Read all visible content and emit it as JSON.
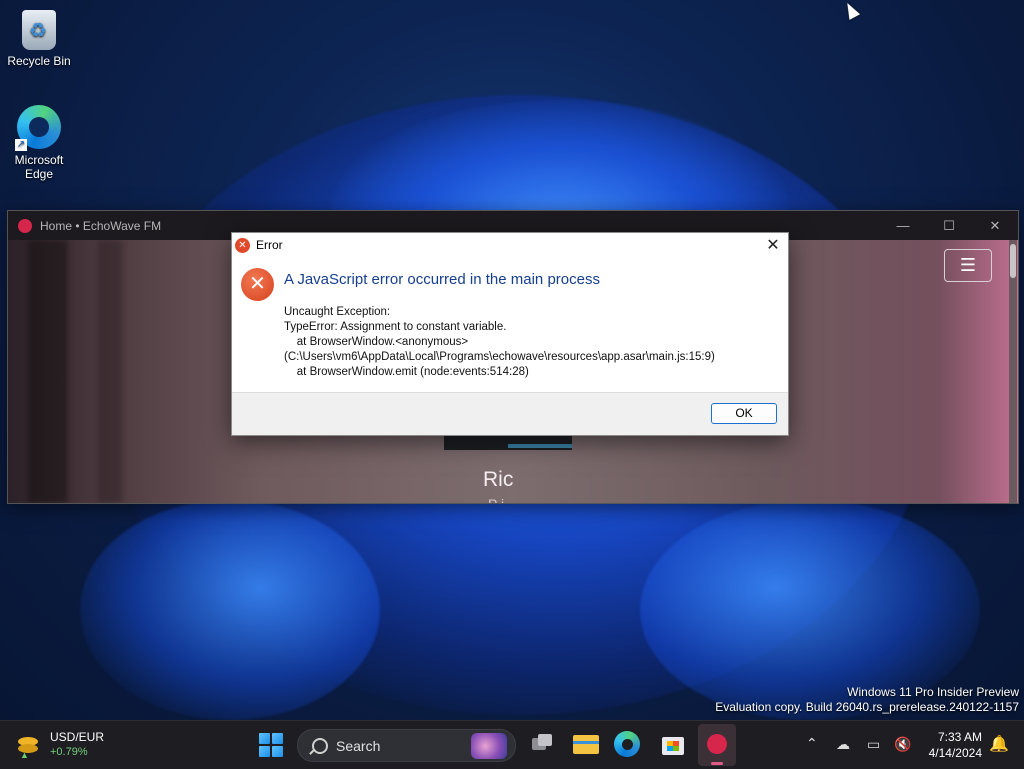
{
  "desktop": {
    "icons": [
      {
        "label": "Recycle Bin"
      },
      {
        "label": "Microsoft Edge"
      }
    ]
  },
  "app_window": {
    "title": "Home • EchoWave FM",
    "controls": {
      "minimize": "—",
      "maximize": "☐",
      "close": "✕"
    },
    "menu_glyph": "☰",
    "now_playing_title": "Ric",
    "now_playing_sub": "P     i"
  },
  "dialog": {
    "title": "Error",
    "close_glyph": "✕",
    "main_instruction": "A JavaScript error occurred in the main process",
    "details": "Uncaught Exception:\nTypeError: Assignment to constant variable.\n    at BrowserWindow.<anonymous>\n(C:\\Users\\vm6\\AppData\\Local\\Programs\\echowave\\resources\\app.asar\\main.js:15:9)\n    at BrowserWindow.emit (node:events:514:28)",
    "ok_label": "OK"
  },
  "watermark": {
    "line1": "Windows 11 Pro Insider Preview",
    "line2": "Evaluation copy. Build 26040.rs_prerelease.240122-1157"
  },
  "taskbar": {
    "widget": {
      "name": "USD/EUR",
      "change": "+0.79%"
    },
    "search_label": "Search",
    "apps": [
      "task-view",
      "file-explorer",
      "microsoft-edge",
      "microsoft-store",
      "echowave-fm"
    ],
    "tray": {
      "chevron": "⌃"
    },
    "clock": {
      "time": "7:33 AM",
      "date": "4/14/2024"
    }
  },
  "colors": {
    "accent_blue": "#1f6fd1",
    "error_red": "#d7401e",
    "echowave_brand": "#d6264b",
    "dialog_heading": "#163f8f"
  }
}
